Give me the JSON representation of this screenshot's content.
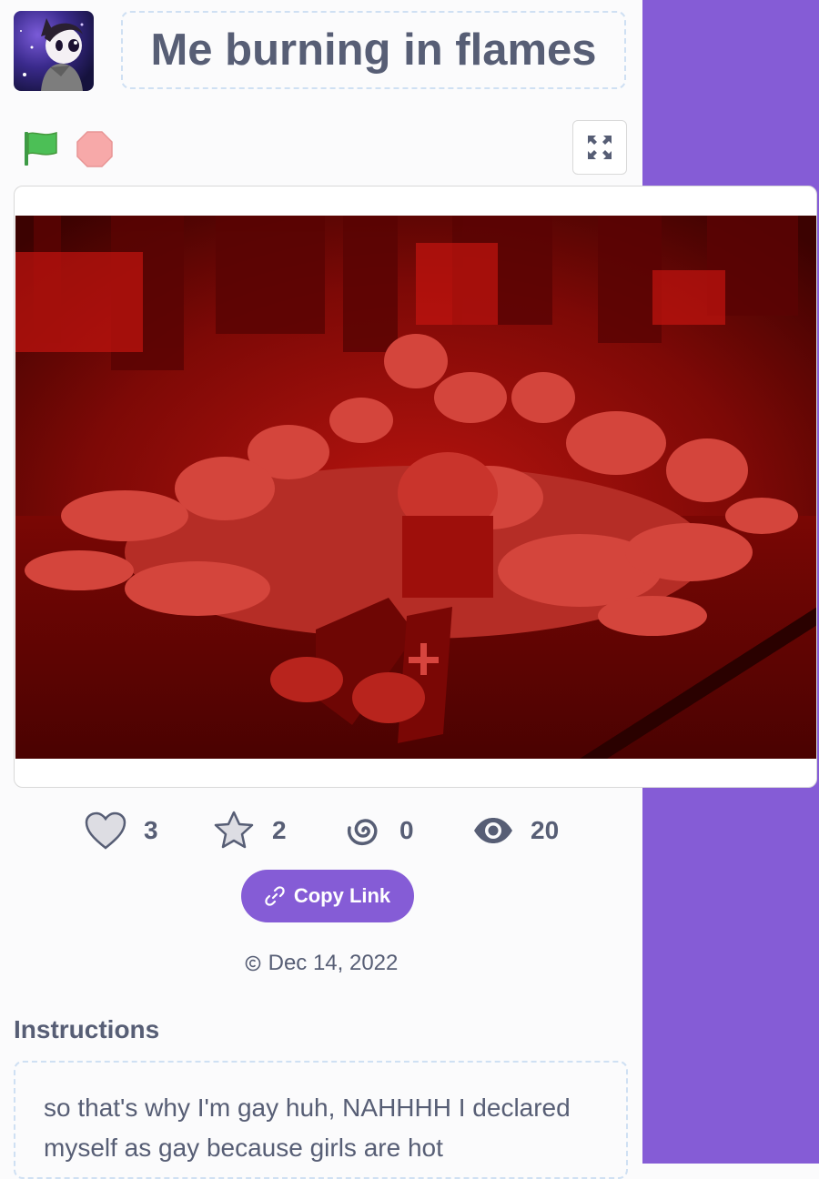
{
  "colors": {
    "accent": "#855cd6",
    "text": "#575e75",
    "flag_green": "#4cbf56",
    "stop_red": "#f7a9a9",
    "stage_red": "#8a0b08"
  },
  "project": {
    "title": "Me burning in flames",
    "author_avatar_icon": "avatar-image"
  },
  "controls": {
    "green_flag_icon": "green-flag-icon",
    "stop_icon": "stop-sign-icon",
    "fullscreen_icon": "fullscreen-icon"
  },
  "stats": {
    "loves": "3",
    "favorites": "2",
    "remixes": "0",
    "views": "20"
  },
  "share": {
    "copy_link_label": "Copy Link"
  },
  "meta": {
    "date": "Dec 14, 2022"
  },
  "instructions": {
    "heading": "Instructions",
    "line1": "so that's why I'm gay huh, NAHHHH I declared",
    "line2": "myself as gay because girls are hot"
  }
}
